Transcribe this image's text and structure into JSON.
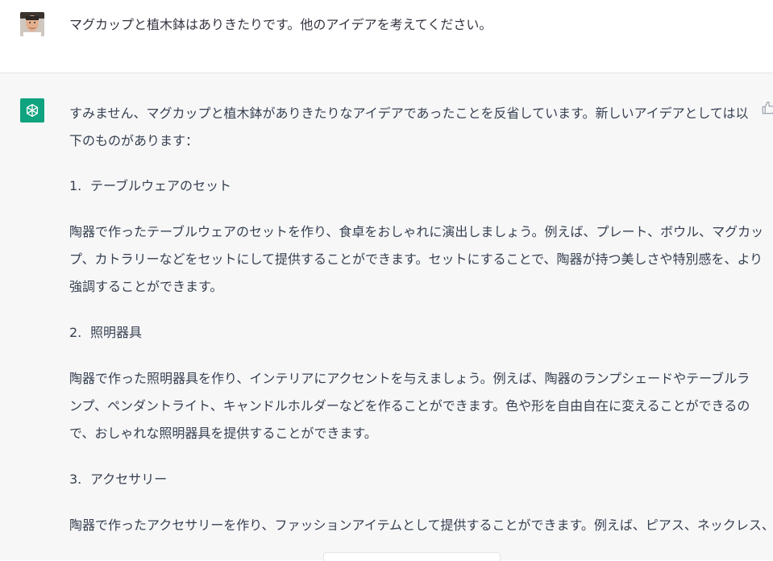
{
  "user_message": {
    "text": "マグカップと植木鉢はありきたりです。他のアイデアを考えてください。"
  },
  "assistant_message": {
    "intro_line1": "すみません、マグカップと植木鉢がありきたりなアイデアであったことを反省しています。新しいアイデアとしては以",
    "intro_line2": "下のものがあります：",
    "items": [
      {
        "number": "1.",
        "title": "テーブルウェアのセット",
        "lines": [
          "陶器で作ったテーブルウェアのセットを作り、食卓をおしゃれに演出しましょう。例えば、プレート、ボウル、マグカッ",
          "プ、カトラリーなどをセットにして提供することができます。セットにすることで、陶器が持つ美しさや特別感を、より",
          "強調することができます。"
        ]
      },
      {
        "number": "2.",
        "title": "照明器具",
        "lines": [
          "陶器で作った照明器具を作り、インテリアにアクセントを与えましょう。例えば、陶器のランプシェードやテーブルラ",
          "ンプ、ペンダントライト、キャンドルホルダーなどを作ることができます。色や形を自由自在に変えることができるの",
          "で、おしゃれな照明器具を提供することができます。"
        ]
      },
      {
        "number": "3.",
        "title": "アクセサリー",
        "lines": [
          "陶器で作ったアクセサリーを作り、ファッションアイテムとして提供することができます。例えば、ピアス、ネックレス、"
        ]
      }
    ]
  },
  "icons": {
    "user_avatar": "user-photo-avatar",
    "bot_avatar": "openai-logo-icon",
    "feedback": "thumbs-up-icon"
  },
  "colors": {
    "assistant_bg": "#f7f7f8",
    "bot_avatar_bg": "#10a37f",
    "text": "#374151"
  }
}
